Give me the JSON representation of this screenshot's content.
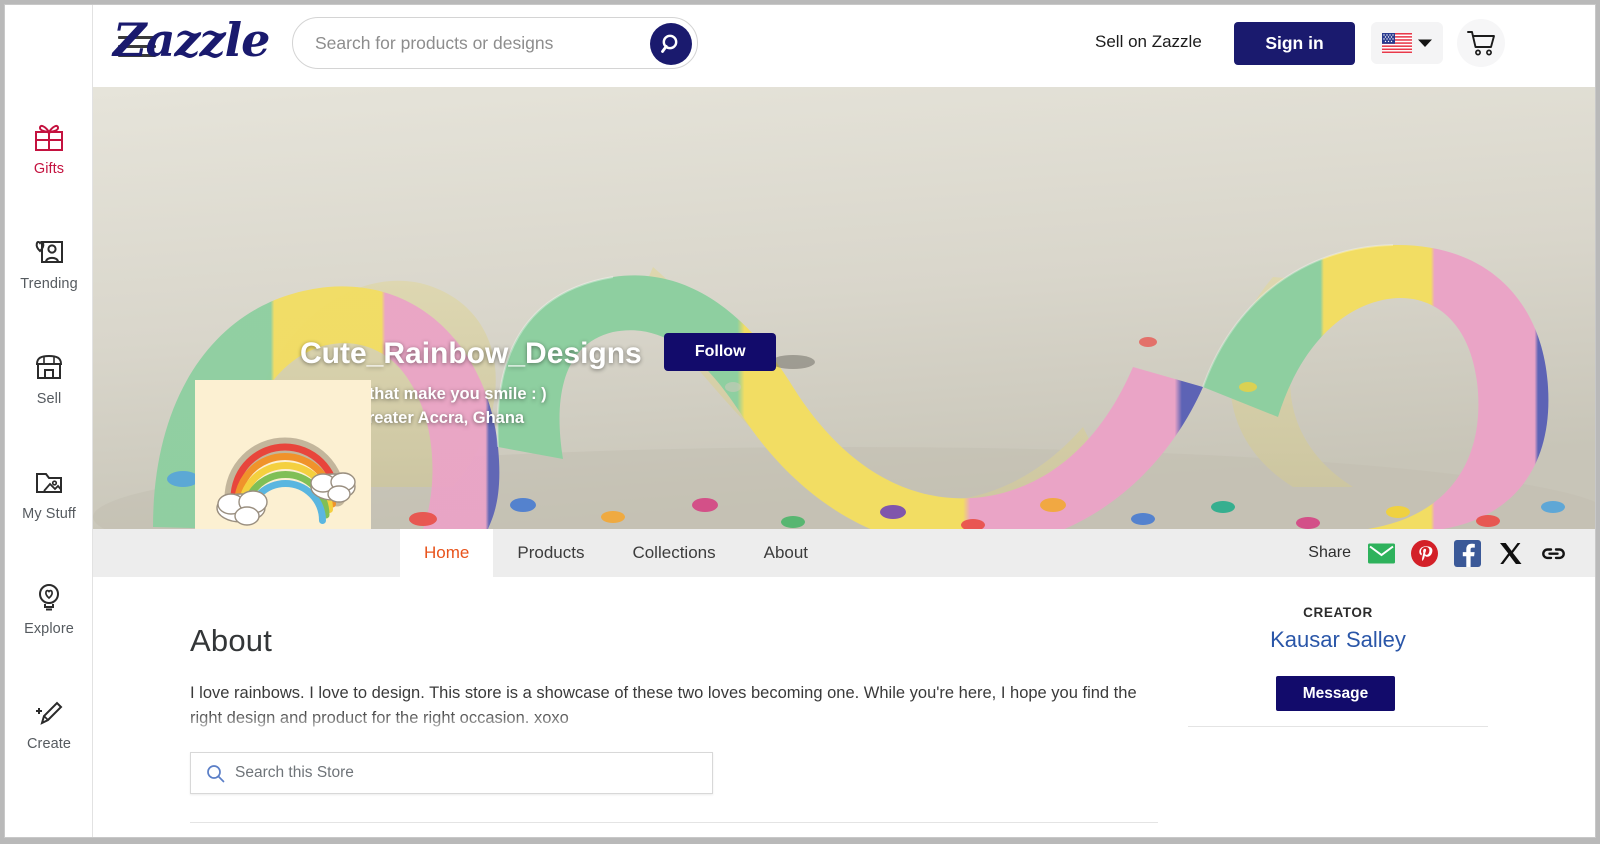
{
  "header": {
    "logo_text": "Zazzle",
    "menu_icon": "hamburger-menu-icon",
    "search": {
      "placeholder": "Search for products or designs",
      "value": "",
      "button_icon": "search-icon"
    },
    "sell_link": "Sell on Zazzle",
    "signin_label": "Sign in",
    "locale_icon": "us-flag-icon",
    "locale_chevron": "chevron-down-icon",
    "cart_icon": "shopping-cart-icon"
  },
  "sidebar": {
    "items": [
      {
        "label": "Gifts",
        "icon": "gift-icon",
        "accent": "#c4123f"
      },
      {
        "label": "Trending",
        "icon": "trending-icon",
        "accent": "#555a5f"
      },
      {
        "label": "Sell",
        "icon": "shop-icon",
        "accent": "#555a5f"
      },
      {
        "label": "My Stuff",
        "icon": "folder-image-icon",
        "accent": "#555a5f"
      },
      {
        "label": "Explore",
        "icon": "lightbulb-heart-icon",
        "accent": "#555a5f"
      },
      {
        "label": "Create",
        "icon": "pencil-sparkle-icon",
        "accent": "#555a5f"
      }
    ]
  },
  "store": {
    "name": "Cute_Rainbow_Designs",
    "follow_label": "Follow",
    "tagline": "Designs that make you smile : )",
    "location": "Accra, Greater Accra, Ghana",
    "avatar_icon": "rainbow-clouds-avatar",
    "banner_description": "pastel striped party ribbon with confetti"
  },
  "tabs": [
    {
      "label": "Home",
      "active": true
    },
    {
      "label": "Products",
      "active": false
    },
    {
      "label": "Collections",
      "active": false
    },
    {
      "label": "About",
      "active": false
    }
  ],
  "share": {
    "label": "Share",
    "icons": [
      {
        "name": "email-share-icon",
        "color": "#2eb25c"
      },
      {
        "name": "pinterest-share-icon",
        "color": "#d32028"
      },
      {
        "name": "facebook-share-icon",
        "color": "#3b5998"
      },
      {
        "name": "x-twitter-share-icon",
        "color": "#0f0f0f"
      },
      {
        "name": "copy-link-icon",
        "color": "#141414"
      }
    ]
  },
  "main": {
    "about_title": "About",
    "about_text": "I love rainbows. I love to design. This store is a showcase of these two loves becoming one. While you're here, I hope you find the right design and product for the right occasion. xoxo",
    "store_search": {
      "placeholder": "Search this Store",
      "value": "",
      "icon": "search-icon"
    }
  },
  "creator": {
    "label": "CREATOR",
    "name": "Kausar Salley",
    "message_label": "Message"
  },
  "colors": {
    "brand_navy": "#1a1a6e",
    "button_navy": "#120b6b",
    "active_tab": "#e8531b",
    "link_blue": "#2a56a8",
    "gift_red": "#c4123f",
    "tabbar_gray": "#ededed",
    "avatar_bg": "#fcf0d2"
  }
}
